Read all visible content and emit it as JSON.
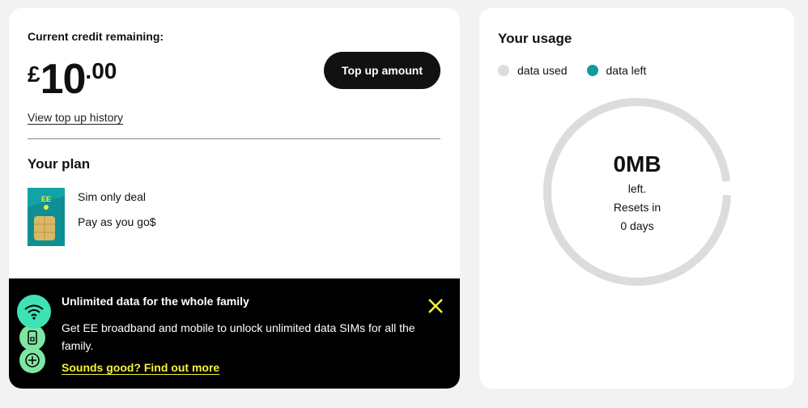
{
  "credit": {
    "label": "Current credit remaining:",
    "currency": "£",
    "whole": "10",
    "decimal": ".00",
    "topup_label": "Top up amount",
    "history_link": "View top up history"
  },
  "plan": {
    "title": "Your plan",
    "line1": "Sim only deal",
    "line2": "Pay as you go$",
    "icon": "ee-sim-card-icon"
  },
  "promo": {
    "title": "Unlimited data for the whole family",
    "body": "Get EE broadband and mobile to unlock unlimited data SIMs for all the family.",
    "link": "Sounds good? Find out more",
    "icons": [
      "wifi-icon",
      "phone-icon",
      "plus-icon"
    ],
    "close_icon": "close-icon"
  },
  "usage": {
    "title": "Your usage",
    "legend": [
      {
        "label": "data used",
        "color": "#dcdcdc"
      },
      {
        "label": "data left",
        "color": "#119aa0"
      }
    ],
    "amount": "0MB",
    "left_label": "left.",
    "resets_label": "Resets in",
    "days_label": "0 days",
    "data_left_fraction": 0
  },
  "colors": {
    "brand_teal": "#119aa0",
    "promo_bg": "#000000",
    "promo_link": "#f3f33a",
    "button_bg": "#111111"
  }
}
